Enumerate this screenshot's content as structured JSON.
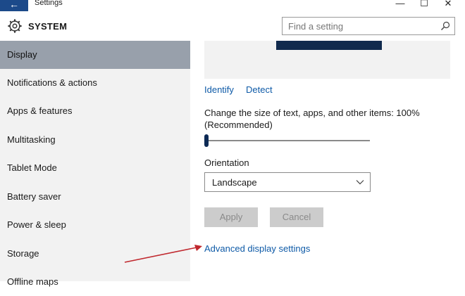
{
  "window": {
    "title": "Settings",
    "back_glyph": "←",
    "minimize_glyph": "—",
    "maximize_glyph": "☐",
    "close_glyph": "✕"
  },
  "header": {
    "section_title": "SYSTEM",
    "icon": "gear-icon",
    "search_placeholder": "Find a setting",
    "search_icon": "search-icon"
  },
  "sidebar": {
    "items": [
      {
        "label": "Display",
        "active": true
      },
      {
        "label": "Notifications & actions"
      },
      {
        "label": "Apps & features"
      },
      {
        "label": "Multitasking"
      },
      {
        "label": "Tablet Mode"
      },
      {
        "label": "Battery saver"
      },
      {
        "label": "Power & sleep"
      },
      {
        "label": "Storage"
      },
      {
        "label": "Offline maps"
      }
    ]
  },
  "display": {
    "identify_label": "Identify",
    "detect_label": "Detect",
    "scale_label_line1": "Change the size of text, apps, and other items: 100%",
    "scale_label_line2": "(Recommended)",
    "scale_value_percent": 0,
    "orientation_label": "Orientation",
    "orientation_value": "Landscape",
    "apply_label": "Apply",
    "cancel_label": "Cancel",
    "advanced_link": "Advanced display settings"
  },
  "colors": {
    "accent": "#1c4a8a",
    "active_nav": "#98a0ab",
    "link": "#0e5aa7",
    "annotation_arrow": "#c0282e"
  }
}
